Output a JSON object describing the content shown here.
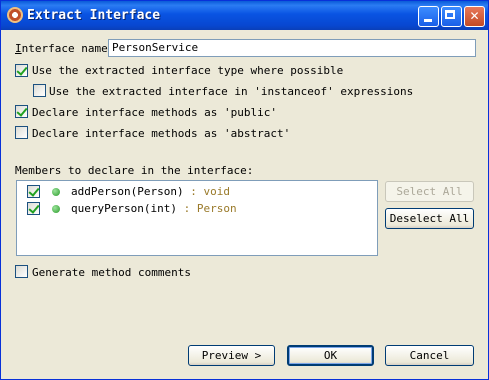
{
  "window": {
    "title": "Extract Interface"
  },
  "interface_name": {
    "label": "Interface name:",
    "value": "PersonService"
  },
  "options": {
    "use_type": {
      "label": "Use the extracted interface type where possible",
      "checked": true
    },
    "use_instanceof": {
      "label": "Use the extracted interface in 'instanceof' expressions",
      "checked": false
    },
    "declare_public": {
      "label": "Declare interface methods as 'public'",
      "checked": true
    },
    "declare_abstract": {
      "label": "Declare interface methods as 'abstract'",
      "checked": false
    }
  },
  "members": {
    "label": "Members to declare in the interface:",
    "items": [
      {
        "name": "addPerson(Person)",
        "type": " : void",
        "checked": true
      },
      {
        "name": "queryPerson(int)",
        "type": " : Person",
        "checked": true
      }
    ],
    "select_all": "Select All",
    "deselect_all": "Deselect All"
  },
  "generate_comments": {
    "label": "Generate method comments",
    "checked": false
  },
  "buttons": {
    "preview": "Preview >",
    "ok": "OK",
    "cancel": "Cancel"
  }
}
